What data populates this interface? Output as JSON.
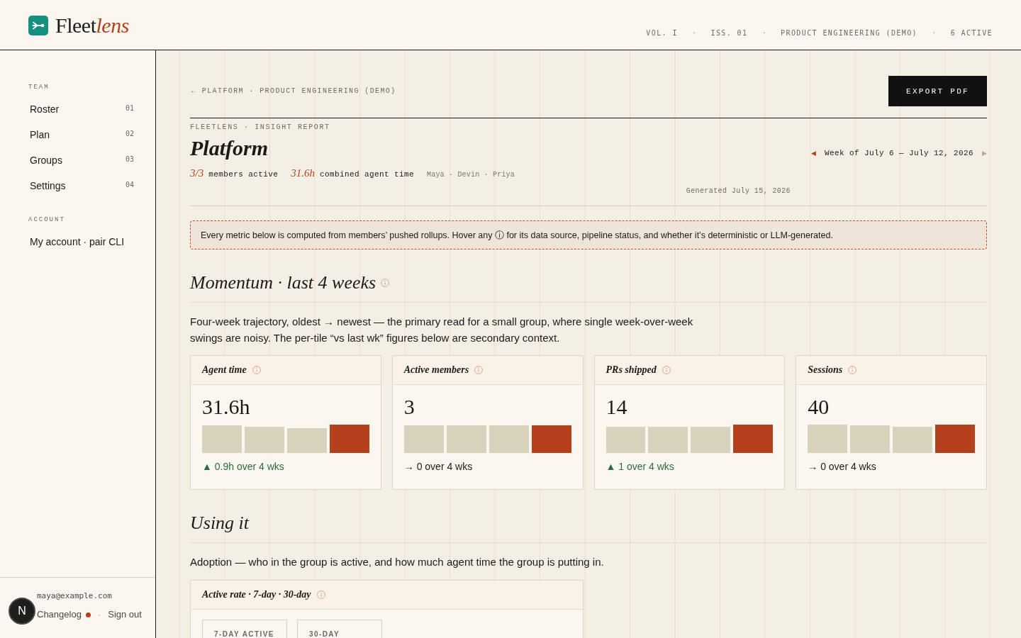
{
  "brand": {
    "name": "Fleet",
    "accent": "lens"
  },
  "masthead": [
    {
      "kind": "label",
      "text": "VOL. I"
    },
    {
      "kind": "separator",
      "text": "·"
    },
    {
      "kind": "label",
      "text": "ISS. 01"
    },
    {
      "kind": "separator",
      "text": "·"
    },
    {
      "kind": "label",
      "text": "PRODUCT ENGINEERING (DEMO)"
    },
    {
      "kind": "separator",
      "text": "·"
    },
    {
      "kind": "label",
      "text": "6 ACTIVE"
    }
  ],
  "sidebar": {
    "sections": [
      {
        "label": "TEAM",
        "items": [
          {
            "label": "Roster",
            "number": "01",
            "selected": false
          },
          {
            "label": "Plan",
            "number": "02",
            "selected": false
          },
          {
            "label": "Groups",
            "number": "03",
            "selected": false
          },
          {
            "label": "Settings",
            "number": "04",
            "selected": false
          }
        ]
      },
      {
        "label": "ACCOUNT",
        "items": [
          {
            "label": "My account · pair CLI",
            "selected": false
          }
        ]
      }
    ],
    "footer": {
      "email": "maya@example.com",
      "changelog": {
        "label": "Changelog",
        "unread": true
      },
      "separator": "·",
      "sign_out": "Sign out"
    }
  },
  "floating_button": "N",
  "breadcrumb": "← PLATFORM · PRODUCT ENGINEERING (DEMO)",
  "export_button": "EXPORT PDF",
  "report": {
    "kicker": "FLEETLENS · INSIGHT REPORT",
    "title": "Platform",
    "stats": [
      {
        "figure": "3/3",
        "caption": "members active"
      },
      {
        "figure": "31.6h",
        "caption": "combined agent time"
      }
    ],
    "members": "Maya · Devin · Priya",
    "week": {
      "prev": {
        "glyph": "◀",
        "disabled": false
      },
      "label": "Week of July 6 — July 12, 2026",
      "next": {
        "glyph": "▶",
        "disabled": true
      }
    },
    "generated": "Generated July 15, 2026"
  },
  "notice": "Every metric below is computed from members’ pushed rollups. Hover any ⓘ for its data source, pipeline status, and whether it’s deterministic or LLM-generated.",
  "sections": [
    {
      "kind": "tiles",
      "title": "Momentum · last 4 weeks",
      "info": true,
      "description": "Four-week trajectory, oldest → newest — the primary read for a small group, where single week-over-week swings are noisy. The per-tile “vs last wk” figures below are secondary context.",
      "tiles": [
        {
          "kind": "up",
          "title": "Agent time",
          "value": "31.6h",
          "delta": "▲ 0.9h over 4 wks"
        },
        {
          "kind": "flat",
          "title": "Active members",
          "value": "3",
          "delta": "→ 0 over 4 wks"
        },
        {
          "kind": "up",
          "title": "PRs shipped",
          "value": "14",
          "delta": "▲ 1 over 4 wks"
        },
        {
          "kind": "flat",
          "title": "Sessions",
          "value": "40",
          "delta": "→ 0 over 4 wks"
        }
      ]
    },
    {
      "kind": "cards",
      "title": "Using it",
      "info": false,
      "description": "Adoption — who in the group is active, and how much agent time the group is putting in.",
      "cards": [
        {
          "title": "Active rate · 7-day · 30-day",
          "panels": [
            "7-DAY ACTIVE",
            "30-DAY"
          ]
        }
      ]
    }
  ]
}
